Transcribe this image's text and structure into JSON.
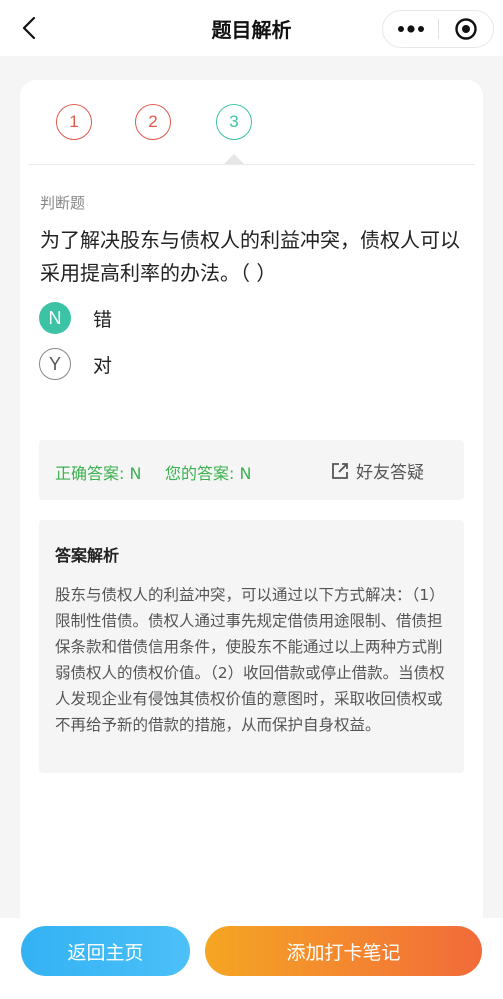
{
  "nav": {
    "title": "题目解析",
    "back_icon": "chevron-left-icon",
    "more_icon": "more-dots-icon",
    "target_icon": "target-icon"
  },
  "question_nav": {
    "items": [
      {
        "label": "1",
        "state": "wrong"
      },
      {
        "label": "2",
        "state": "wrong"
      },
      {
        "label": "3",
        "state": "current"
      }
    ]
  },
  "question": {
    "type": "判断题",
    "text": "为了解决股东与债权人的利益冲突，债权人可以采用提高利率的办法。（  ）",
    "options": [
      {
        "key": "N",
        "text": "错",
        "selected": true
      },
      {
        "key": "Y",
        "text": "对",
        "selected": false
      }
    ]
  },
  "answer": {
    "correct": "正确答案: N",
    "yours": "您的答案: N",
    "ask_friend": "好友答疑"
  },
  "analysis": {
    "title": "答案解析",
    "text": "股东与债权人的利益冲突，可以通过以下方式解决：（1）限制性借债。债权人通过事先规定借债用途限制、借债担保条款和借债信用条件，使股东不能通过以上两种方式削弱债权人的债权价值。（2）收回借款或停止借款。当债权人发现企业有侵蚀其债权价值的意图时，采取收回债权或不再给予新的借款的措施，从而保护自身权益。"
  },
  "bottom": {
    "home": "返回主页",
    "add_note": "添加打卡笔记"
  },
  "colors": {
    "wrong": "#e05a4e",
    "current": "#3cc3a6",
    "correct_text": "#3bb14f",
    "home_btn": "#3ab6f6",
    "note_btn_start": "#f5a623",
    "note_btn_end": "#f26b3a"
  }
}
